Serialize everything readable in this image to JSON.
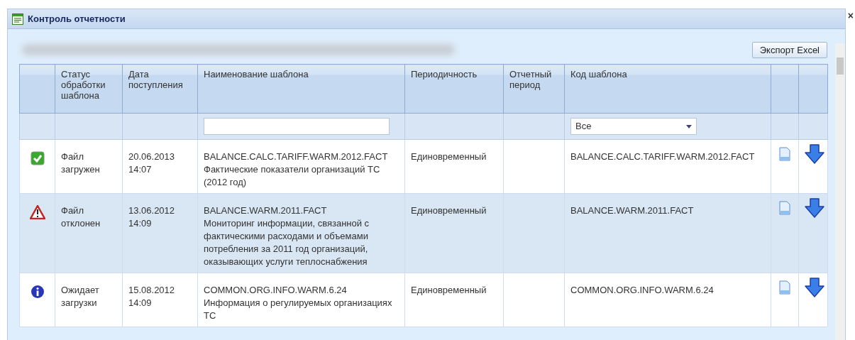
{
  "window": {
    "title": "Контроль отчетности",
    "close": "×"
  },
  "toolbar": {
    "export_button": "Экспорт Excel"
  },
  "table": {
    "columns": [
      {
        "label": "Статус обработки шаблона"
      },
      {
        "label": "Дата поступления"
      },
      {
        "label": "Наименование шаблона"
      },
      {
        "label": "Периодичность"
      },
      {
        "label": "Отчетный период"
      },
      {
        "label": "Код шаблона"
      }
    ],
    "filters": {
      "name_field": {
        "kind": "text"
      },
      "code_dropdown": {
        "value": "Все"
      }
    },
    "rows": [
      {
        "kind": "ok",
        "status": "Файл загружен",
        "date": "20.06.2013\n14:07",
        "name": "BALANCE.CALC.TARIFF.WARM.2012.FACT\nФактические показатели организаций ТС (2012 год)",
        "periodicity": "Единовременный",
        "code": "BALANCE.CALC.TARIFF.WARM.2012.FACT",
        "selected": false
      },
      {
        "kind": "error",
        "status": "Файл отклонен",
        "date": "13.06.2012\n14:09",
        "name": "BALANCE.WARM.2011.FACT\nМониторинг информации, связанной с фактическими расходами и объемами потребления за 2011 год организаций, оказывающих услуги теплоснабжения",
        "periodicity": "Единовременный",
        "code": "BALANCE.WARM.2011.FACT",
        "selected": true
      },
      {
        "kind": "info",
        "status": "Ожидает загрузки",
        "date": "15.08.2012\n14:09",
        "name": "COMMON.ORG.INFO.WARM.6.24\nИнформация о регулируемых организациях ТС",
        "periodicity": "Единовременный",
        "code": "COMMON.ORG.INFO.WARM.6.24",
        "selected": false
      }
    ]
  }
}
